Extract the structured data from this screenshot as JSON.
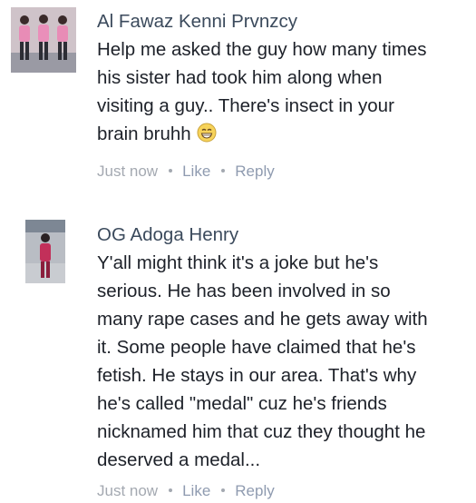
{
  "comments": [
    {
      "author": "Al Fawaz Kenni Prvnzcy",
      "lines": [
        "Help me asked the guy how many times",
        "his sister had took him along when",
        "visiting a guy.. There's insect in your",
        "brain bruhh"
      ],
      "emoji_icon": "grinning-face-emoji",
      "timestamp": "Just now",
      "like_label": "Like",
      "reply_label": "Reply"
    },
    {
      "author": "OG Adoga Henry",
      "lines": [
        "Y'all might think it's a joke but he's",
        "serious. He has been involved in so",
        "many rape cases and he gets away with",
        "it. Some people have claimed that he's",
        "fetish. He stays in our area. That's why",
        "he's called \"medal\" cuz he's friends",
        "nicknamed him that cuz they thought he",
        "deserved a medal..."
      ],
      "timestamp": "Just now",
      "like_label": "Like",
      "reply_label": "Reply"
    }
  ]
}
